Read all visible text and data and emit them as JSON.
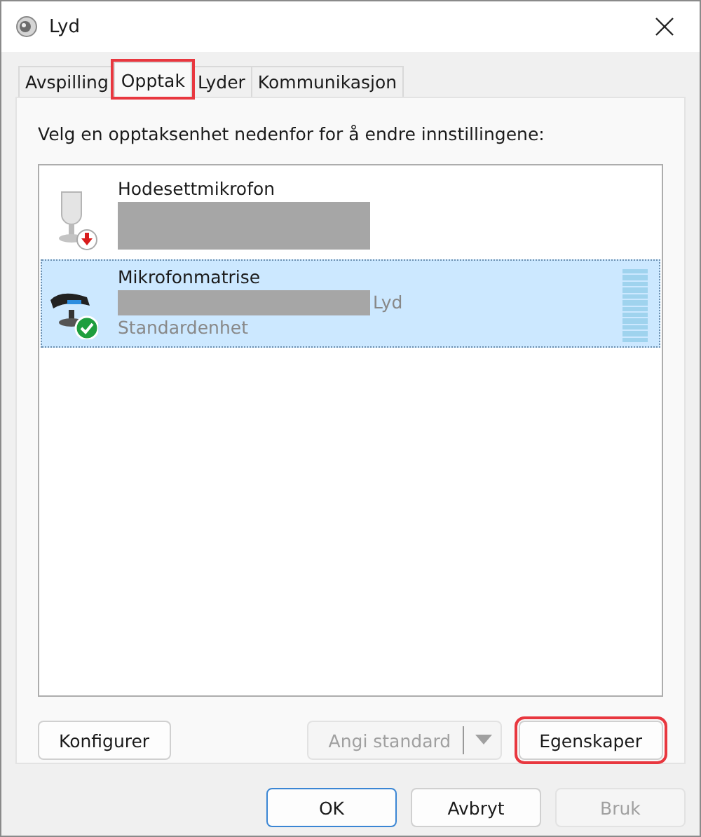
{
  "window": {
    "title": "Lyd"
  },
  "tabs": [
    {
      "label": "Avspilling",
      "selected": false,
      "highlighted": false
    },
    {
      "label": "Opptak",
      "selected": true,
      "highlighted": true
    },
    {
      "label": "Lyder",
      "selected": false,
      "highlighted": false
    },
    {
      "label": "Kommunikasjon",
      "selected": false,
      "highlighted": false
    }
  ],
  "instruction": "Velg en opptaksenhet nedenfor for å endre innstillingene:",
  "devices": [
    {
      "name": "Hodesettmikrofon",
      "kind": "disconnected",
      "selected": false
    },
    {
      "name": "Mikrofonmatrise",
      "kind": "default",
      "detail": "Lyd",
      "state_text": "Standardenhet",
      "selected": true
    }
  ],
  "panel_buttons": [
    {
      "label": "Konfigurer",
      "kind": "plain",
      "disabled": false,
      "highlighted": false
    },
    {
      "label": "Angi standard",
      "kind": "split",
      "disabled": true,
      "highlighted": false
    },
    {
      "label": "Egenskaper",
      "kind": "plain",
      "disabled": false,
      "highlighted": true
    }
  ],
  "dialog_buttons": [
    {
      "label": "OK",
      "default": true,
      "disabled": false
    },
    {
      "label": "Avbryt",
      "default": false,
      "disabled": false
    },
    {
      "label": "Bruk",
      "default": false,
      "disabled": true
    }
  ]
}
